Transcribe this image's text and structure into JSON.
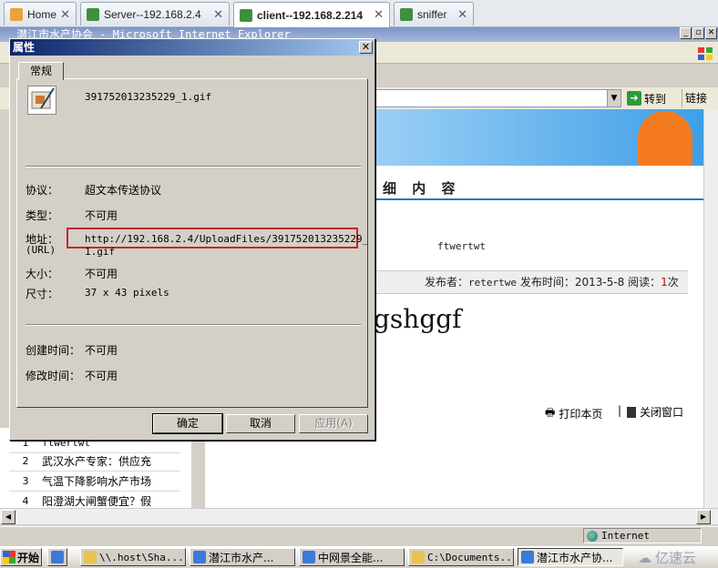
{
  "host_tabs": [
    {
      "label": "Home",
      "active": false
    },
    {
      "label": "Server--192.168.2.4",
      "active": false
    },
    {
      "label": "client--192.168.2.214",
      "active": true
    },
    {
      "label": "sniffer",
      "active": false
    }
  ],
  "ie": {
    "window_title": "潜江市水产协会 - Microsoft Internet Explorer",
    "goto_label": "转到",
    "links_label": "链接"
  },
  "page": {
    "detail_heading": "细 内 容",
    "article_title": "ftwertwt",
    "meta_publisher_label": "发布者：",
    "meta_publisher": "retertwe",
    "meta_time_label": " 发布时间：",
    "meta_time": "2013-5-8",
    "meta_reads_label": " 阅读：",
    "meta_reads": "1",
    "meta_reads_unit": "次",
    "article_body": "gshggf",
    "print_label": "打印本页",
    "separator": "|",
    "close_label": "关闭窗口"
  },
  "rank_list": [
    {
      "num": "1",
      "title": "ftwertwt"
    },
    {
      "num": "2",
      "title": "武汉水产专家：供应充"
    },
    {
      "num": "3",
      "title": "气温下降影响水产市场"
    },
    {
      "num": "4",
      "title": "阳澄湖大闸蟹便宜？假"
    }
  ],
  "status": {
    "zone": "Internet"
  },
  "taskbar": {
    "start_label": "开始",
    "tasks": [
      {
        "label": "\\\\.host\\Sha...",
        "active": false
      },
      {
        "label": "潜江市水产...",
        "active": false
      },
      {
        "label": "中网景全能...",
        "active": false
      },
      {
        "label": "C:\\Documents...",
        "active": false
      },
      {
        "label": "潜江市水产协...",
        "active": true
      }
    ],
    "watermark": "亿速云"
  },
  "dialog": {
    "title": "属性",
    "close_glyph": "✕",
    "tab_label": "常规",
    "file_name": "391752013235229_1.gif",
    "protocol_label": "协议：",
    "protocol_value": "超文本传送协议",
    "type_label": "类型：",
    "type_value": "不可用",
    "address_label": "地址：",
    "address_sublabel": "(URL)",
    "address_line1": "http://192.168.2.4/UploadFiles/391752013235229_",
    "address_line2": "1.gif",
    "size_label": "大小：",
    "size_value": "不可用",
    "dimensions_label": "尺寸：",
    "dimensions_value": "37  x  43  pixels",
    "created_label": "创建时间：",
    "created_value": "不可用",
    "modified_label": "修改时间：",
    "modified_value": "不可用",
    "ok_label": "确定",
    "cancel_label": "取消",
    "apply_label": "应用(A)"
  }
}
